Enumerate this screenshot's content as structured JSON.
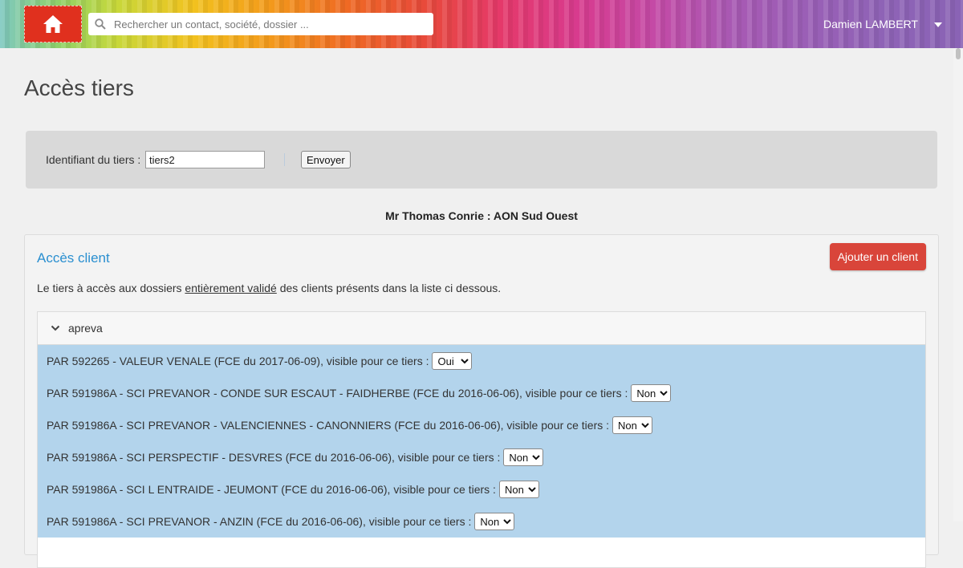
{
  "header": {
    "search_placeholder": "Rechercher un contact, société, dossier ...",
    "user_name": "Damien LAMBERT"
  },
  "page": {
    "title": "Accès tiers"
  },
  "form": {
    "label": "Identifiant du tiers :",
    "tiers_id_value": "tiers2",
    "submit_label": "Envoyer"
  },
  "tiers_name": "Mr Thomas Conrie : AON Sud Ouest",
  "client_access": {
    "title": "Accès client",
    "add_button": "Ajouter un client",
    "desc_before": "Le tiers à accès aux dossiers ",
    "desc_emph": "entièrement validé",
    "desc_after": " des clients présents dans la liste ci dessous.",
    "group_name": "apreva",
    "options": [
      "Oui",
      "Non"
    ],
    "rows": [
      {
        "text": "PAR 592265 - VALEUR VENALE (FCE du 2017-06-09), visible pour ce tiers :",
        "visible": "Oui"
      },
      {
        "text": "PAR 591986A - SCI PREVANOR - CONDE SUR ESCAUT - FAIDHERBE (FCE du 2016-06-06), visible pour ce tiers :",
        "visible": "Non"
      },
      {
        "text": "PAR 591986A - SCI PREVANOR - VALENCIENNES - CANONNIERS (FCE du 2016-06-06), visible pour ce tiers :",
        "visible": "Non"
      },
      {
        "text": "PAR 591986A - SCI PERSPECTIF - DESVRES (FCE du 2016-06-06), visible pour ce tiers :",
        "visible": "Non"
      },
      {
        "text": "PAR 591986A - SCI L ENTRAIDE - JEUMONT (FCE du 2016-06-06), visible pour ce tiers :",
        "visible": "Non"
      },
      {
        "text": "PAR 591986A - SCI PREVANOR - ANZIN (FCE du 2016-06-06), visible pour ce tiers :",
        "visible": "Non"
      }
    ]
  },
  "colors": {
    "accent_link": "#2a8fd0",
    "home_button": "#e0301e",
    "add_button": "#d9453a",
    "row_background": "#b3d4ec"
  }
}
